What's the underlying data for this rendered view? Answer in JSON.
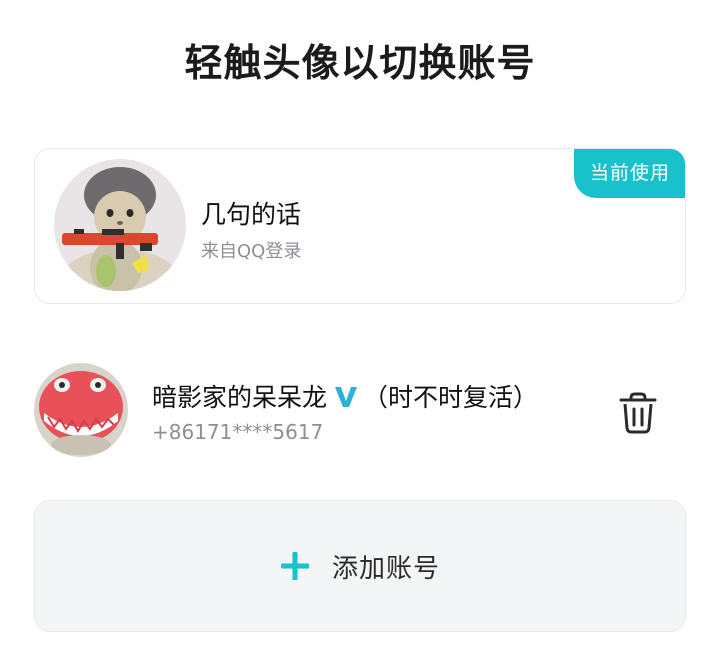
{
  "header": {
    "title": "轻触头像以切换账号"
  },
  "current_account": {
    "badge": "当前使用",
    "name": "几句的话",
    "source": "来自QQ登录"
  },
  "other_accounts": [
    {
      "name_before": "暗影家的呆呆龙",
      "name_after": "（时不时复活）",
      "phone": "+86171****5617"
    }
  ],
  "add_account": {
    "label": "添加账号"
  },
  "icons": {
    "verified": "v-badge-icon",
    "delete": "trash-icon",
    "add": "plus-icon"
  },
  "colors": {
    "accent": "#19c1cc",
    "secondary_text": "#8b8f96",
    "card_border": "#e6e7ea",
    "add_background": "#f4f5f7"
  }
}
